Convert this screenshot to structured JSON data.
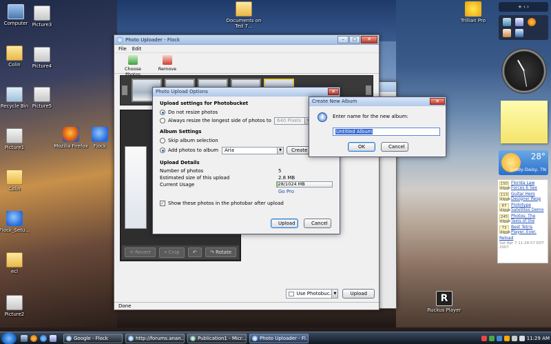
{
  "desktop": {
    "icons": [
      {
        "label": "Computer"
      },
      {
        "label": "Picture3"
      },
      {
        "label": "Documents on Ted 7..."
      },
      {
        "label": "Trillian Pro"
      },
      {
        "label": "Colin"
      },
      {
        "label": "Picture4"
      },
      {
        "label": "Recycle Bin"
      },
      {
        "label": "Picture5"
      },
      {
        "label": "Mozilla Firefox"
      },
      {
        "label": "Flock"
      },
      {
        "label": "Picture1"
      },
      {
        "label": "Colin"
      },
      {
        "label": "Flock_Setu..."
      },
      {
        "label": "ecl"
      },
      {
        "label": "Picture2"
      },
      {
        "label": "Ruckus Player"
      }
    ]
  },
  "uploader": {
    "title": "Photo Uploader - Flock",
    "menu": [
      "File",
      "Edit"
    ],
    "toolbar": {
      "choose": "Choose Photos",
      "remove": "Remove"
    },
    "rotate": {
      "revert": "Revert",
      "crop": "Crop",
      "rotate": "Rotate"
    },
    "upload_via": "Use Photobuc...",
    "upload_button": "Upload",
    "status": "Done"
  },
  "options": {
    "title": "Photo Upload Options",
    "section1": "Upload settings for Photobucket",
    "no_resize": "Do not resize photos",
    "resize": "Always resize the longest side of photos to",
    "resize_value": "640 Pixels",
    "section2": "Album Settings",
    "skip": "Skip album selection",
    "add": "Add photos to album",
    "album_value": "Aria",
    "create_btn": "Create ...",
    "section3": "Upload Details",
    "num_label": "Number of photos",
    "num_value": "5",
    "size_label": "Estimated size of this upload",
    "size_value": "2.8 MB",
    "usage_label": "Current Usage",
    "usage_value": "28/1024 MB",
    "usage_fraction": 0.027,
    "gopro": "Go Pro",
    "show_photos": "Show these photos in the photobar after upload",
    "upload": "Upload",
    "cancel": "Cancel"
  },
  "new_album": {
    "title": "Create New Album",
    "prompt": "Enter name for the new album:",
    "value": "Untitled Album",
    "ok": "OK",
    "cancel": "Cancel"
  },
  "gadgets": {
    "weather_temp": "28°",
    "weather_city": "Soddy-Daisy, TN",
    "digg": [
      {
        "count": "150 diggs",
        "title": "Florida Law Forces 6 Sex"
      },
      {
        "count": "113 diggs",
        "title": "Guitar Hero Designer Resp"
      },
      {
        "count": "87 diggs",
        "title": "Prototype Satellites Demo"
      },
      {
        "count": "245 diggs",
        "title": "Photos: The Taxis of the"
      },
      {
        "count": "73 diggs",
        "title": "Best Tetris Player. Ever."
      }
    ],
    "digg_reload": "Reload",
    "digg_time": "Sat Apr 7 11:28:57 EDT 2007"
  },
  "taskbar": {
    "tasks": [
      "Google - Flock",
      "http://forums.anan...",
      "Publication1 - Micr...",
      "Photo Uploader - Fl..."
    ],
    "time": "11:29 AM"
  }
}
